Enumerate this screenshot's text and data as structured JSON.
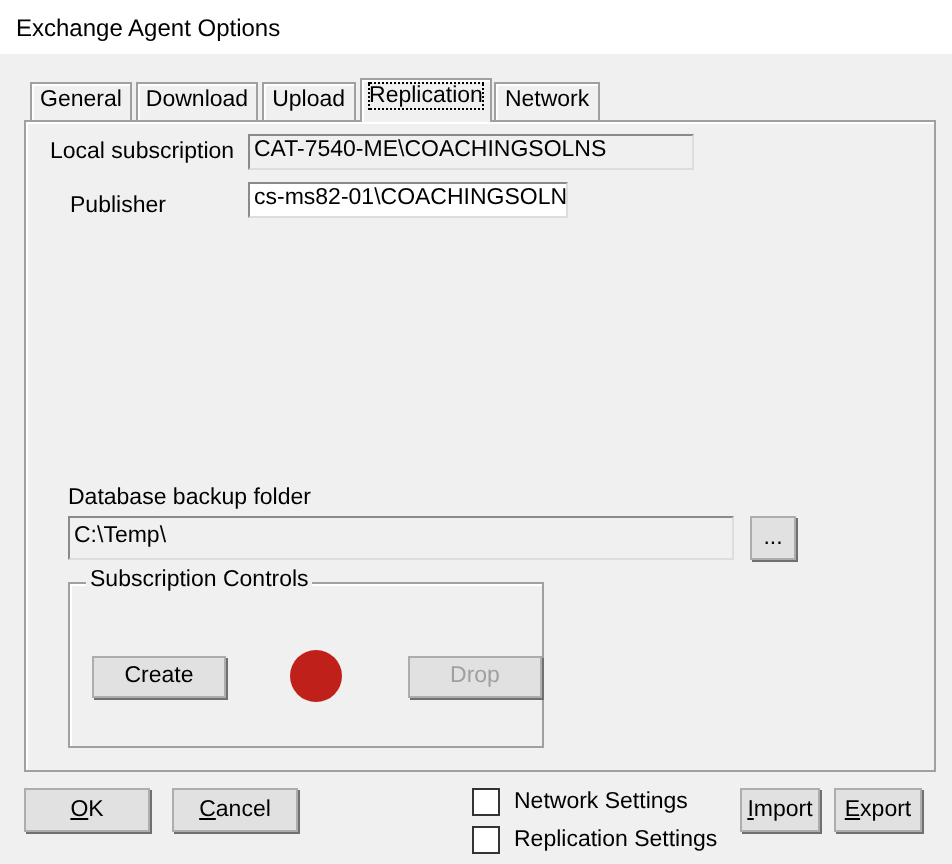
{
  "window": {
    "title": "Exchange Agent Options"
  },
  "tabs": [
    {
      "label": "General",
      "selected": false
    },
    {
      "label": "Download",
      "selected": false
    },
    {
      "label": "Upload",
      "selected": false
    },
    {
      "label": "Replication",
      "selected": true
    },
    {
      "label": "Network",
      "selected": false
    }
  ],
  "local_subscription": {
    "label": "Local subscription",
    "value": "CAT-7540-ME\\COACHINGSOLNS",
    "disabled": true
  },
  "publisher": {
    "label": "Publisher",
    "value": "cs-ms82-01\\COACHINGSOLN",
    "disabled": false
  },
  "backup_folder": {
    "label": "Database backup folder",
    "value": "C:\\Temp\\",
    "disabled": true,
    "browse": "..."
  },
  "subscription_controls": {
    "title": "Subscription Controls",
    "status_light": {
      "color": "#c0201a"
    },
    "buttons": [
      {
        "label": "Create",
        "disabled": false
      },
      {
        "label": "Drop",
        "disabled": true
      }
    ]
  },
  "footer_buttons_left": [
    {
      "accel": "O",
      "rest": "K"
    },
    {
      "accel": "C",
      "rest": "ancel"
    }
  ],
  "checkboxes": [
    {
      "label": "Network Settings",
      "checked": false
    },
    {
      "label": "Replication Settings",
      "checked": false
    }
  ],
  "footer_buttons_right": [
    {
      "accel": "I",
      "rest": "mport"
    },
    {
      "accel": "E",
      "rest": "xport"
    }
  ]
}
